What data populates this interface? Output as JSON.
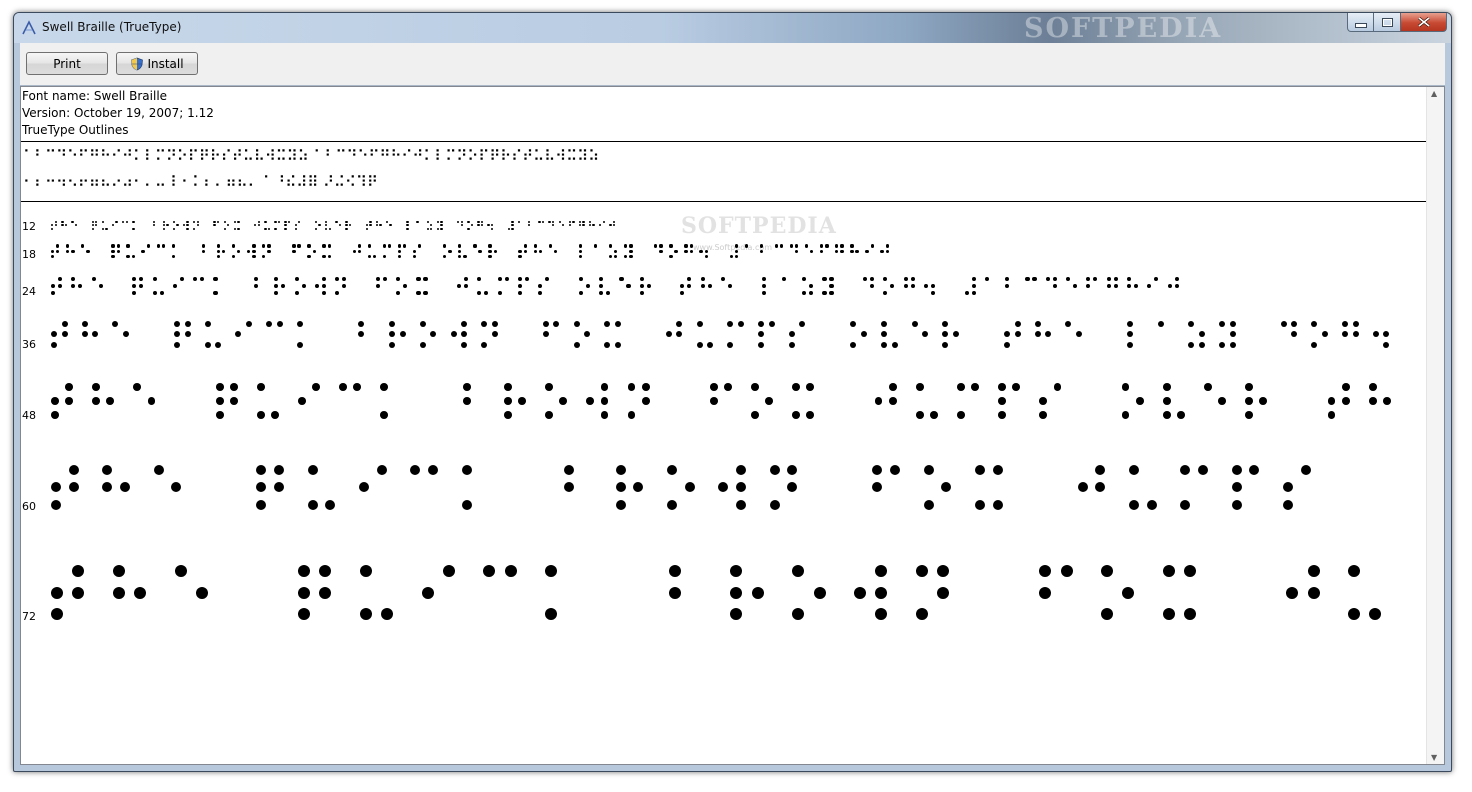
{
  "window": {
    "title": "Swell Braille (TrueType)",
    "watermark": "SOFTPEDIA",
    "minimize_icon": "minimize-icon",
    "maximize_icon": "maximize-icon",
    "close_icon": "close-icon"
  },
  "toolbar": {
    "print_label": "Print",
    "install_label": "Install",
    "install_icon": "uac-shield-icon"
  },
  "font_info": {
    "name": "Font name: Swell Braille",
    "version": "Version: October 19, 2007; 1.12",
    "outlines": "TrueType Outlines"
  },
  "character_set": {
    "lowercase_row": "⠁⠃⠉⠙⠑⠋⠛⠓⠊⠚⠅⠇⠍⠝⠕⠏⠟⠗⠎⠞⠥⠧⠺⠭⠽⠵ ⠁⠃⠉⠙⠑⠋⠛⠓⠊⠚⠅⠇⠍⠝⠕⠏⠟⠗⠎⠞⠥⠧⠺⠭⠽⠵",
    "digits_row": "⠂⠆⠒⠲⠢⠖⠶⠦⠔⠴⠂⠄⠤⠸⠐⠨⠰⠠ ⠶⠦⠄⠈ ⠘⠮⠼⠿ ⠜⠬⠪⠹⠟"
  },
  "samples": [
    {
      "size": "12"
    },
    {
      "size": "18"
    },
    {
      "size": "24"
    },
    {
      "size": "36"
    },
    {
      "size": "48"
    },
    {
      "size": "60"
    },
    {
      "size": "72"
    }
  ],
  "colors": {
    "titlebar": "#b9cce2",
    "close_button": "#c74a33",
    "content_background": "#ffffff",
    "braille_dot": "#000000"
  }
}
